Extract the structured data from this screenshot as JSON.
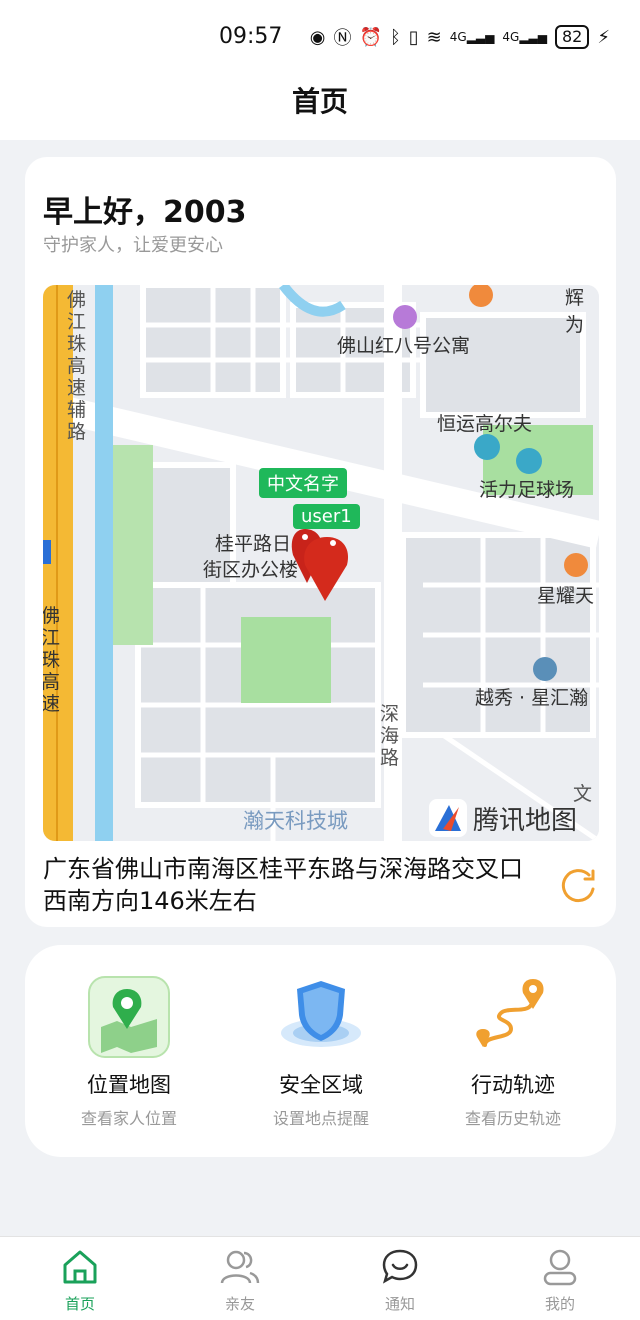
{
  "status": {
    "time": "09:57",
    "battery": "82",
    "network1": "4G",
    "network2": "4G"
  },
  "header": {
    "title": "首页"
  },
  "location_card": {
    "greeting": "早上好，2003",
    "subtitle": "守护家人，让爱更安心",
    "address": "广东省佛山市南海区桂平东路与深海路交叉口西南方向146米左右",
    "map": {
      "places": [
        "佛山红八号公寓",
        "恒运高尔夫",
        "活力足球场",
        "桂平路日",
        "街区办公楼",
        "星耀天",
        "越秀 · 星汇瀚",
        "瀚天科技城",
        "辉为",
        "文",
        "深",
        "海",
        "路"
      ],
      "road_left": [
        "佛",
        "江",
        "珠",
        "高",
        "速",
        "辅",
        "路"
      ],
      "road_left2": [
        "佛",
        "江",
        "珠",
        "高",
        "速"
      ],
      "markers": [
        "中文名字",
        "user1"
      ],
      "brand": "腾讯地图"
    }
  },
  "actions": [
    {
      "label": "位置地图",
      "desc": "查看家人位置",
      "icon": "map-pin-icon"
    },
    {
      "label": "安全区域",
      "desc": "设置地点提醒",
      "icon": "shield-icon"
    },
    {
      "label": "行动轨迹",
      "desc": "查看历史轨迹",
      "icon": "route-icon"
    }
  ],
  "tabs": [
    {
      "label": "首页",
      "icon": "home-icon",
      "active": true
    },
    {
      "label": "亲友",
      "icon": "friends-icon",
      "active": false
    },
    {
      "label": "通知",
      "icon": "message-icon",
      "active": false
    },
    {
      "label": "我的",
      "icon": "user-icon",
      "active": false
    }
  ],
  "colors": {
    "accent": "#1aa15a",
    "marker": "#d42a1c",
    "route": "#f0a030",
    "shield": "#3f8ee8"
  }
}
